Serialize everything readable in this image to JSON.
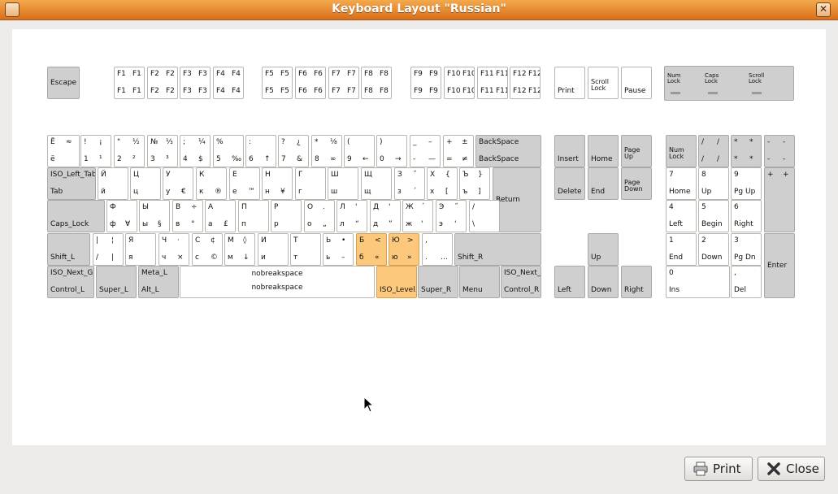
{
  "window": {
    "title": "Keyboard Layout \"Russian\"",
    "close_glyph": "✕"
  },
  "buttons": {
    "print_label": "Print",
    "close_label": "Close"
  },
  "keyboard": {
    "keys": [
      {
        "name": "escape",
        "labels": {
          "ml": "Escape"
        },
        "mod": true
      },
      {
        "name": "f1",
        "labels": {
          "tl": "F1",
          "tr": "F1",
          "bl": "F1",
          "br": "F1"
        }
      },
      {
        "name": "f2",
        "labels": {
          "tl": "F2",
          "tr": "F2",
          "bl": "F2",
          "br": "F2"
        }
      },
      {
        "name": "f3",
        "labels": {
          "tl": "F3",
          "tr": "F3",
          "bl": "F3",
          "br": "F3"
        }
      },
      {
        "name": "f4",
        "labels": {
          "tl": "F4",
          "tr": "F4",
          "bl": "F4",
          "br": "F4"
        }
      },
      {
        "name": "f5",
        "labels": {
          "tl": "F5",
          "tr": "F5",
          "bl": "F5",
          "br": "F5"
        }
      },
      {
        "name": "f6",
        "labels": {
          "tl": "F6",
          "tr": "F6",
          "bl": "F6",
          "br": "F6"
        }
      },
      {
        "name": "f7",
        "labels": {
          "tl": "F7",
          "tr": "F7",
          "bl": "F7",
          "br": "F7"
        }
      },
      {
        "name": "f8",
        "labels": {
          "tl": "F8",
          "tr": "F8",
          "bl": "F8",
          "br": "F8"
        }
      },
      {
        "name": "f9",
        "labels": {
          "tl": "F9",
          "tr": "F9",
          "bl": "F9",
          "br": "F9"
        }
      },
      {
        "name": "f10",
        "labels": {
          "tl": "F10",
          "tr": "F10",
          "bl": "F10",
          "br": "F10"
        }
      },
      {
        "name": "f11",
        "labels": {
          "tl": "F11",
          "tr": "F11",
          "bl": "F11",
          "br": "F11"
        }
      },
      {
        "name": "f12",
        "labels": {
          "tl": "F12",
          "tr": "F12",
          "bl": "F12",
          "br": "F12"
        }
      },
      {
        "name": "print",
        "labels": {
          "bl": "Print"
        }
      },
      {
        "name": "scroll-lock",
        "labels": {
          "ml": "Scroll\nLock"
        }
      },
      {
        "name": "pause",
        "labels": {
          "bl": "Pause"
        }
      },
      {
        "name": "grave",
        "labels": {
          "tl": "Ё",
          "tr": "≈",
          "bl": "ё",
          "br": ""
        }
      },
      {
        "name": "digit-1",
        "labels": {
          "tl": "!",
          "tr": "¡",
          "bl": "1",
          "br": "¹"
        }
      },
      {
        "name": "digit-2",
        "labels": {
          "tl": "\"",
          "tr": "½",
          "bl": "2",
          "br": "²"
        }
      },
      {
        "name": "digit-3",
        "labels": {
          "tl": "№",
          "tr": "⅓",
          "bl": "3",
          "br": "³"
        }
      },
      {
        "name": "digit-4",
        "labels": {
          "tl": ";",
          "tr": "¼",
          "bl": "4",
          "br": "$"
        }
      },
      {
        "name": "digit-5",
        "labels": {
          "tl": "%",
          "tr": "",
          "bl": "5",
          "br": "‰"
        }
      },
      {
        "name": "digit-6",
        "labels": {
          "tl": ":",
          "tr": "",
          "bl": "6",
          "br": "↑"
        }
      },
      {
        "name": "digit-7",
        "labels": {
          "tl": "?",
          "tr": "¿",
          "bl": "7",
          "br": "&"
        }
      },
      {
        "name": "digit-8",
        "labels": {
          "tl": "*",
          "tr": "⅛",
          "bl": "8",
          "br": "∞"
        }
      },
      {
        "name": "digit-9",
        "labels": {
          "tl": "(",
          "tr": "",
          "bl": "9",
          "br": "←"
        }
      },
      {
        "name": "digit-0",
        "labels": {
          "tl": ")",
          "tr": "",
          "bl": "0",
          "br": "→"
        }
      },
      {
        "name": "minus",
        "labels": {
          "tl": "_",
          "tr": "–",
          "bl": "-",
          "br": "—"
        }
      },
      {
        "name": "equal",
        "labels": {
          "tl": "+",
          "tr": "±",
          "bl": "=",
          "br": "≠"
        }
      },
      {
        "name": "backspace",
        "labels": {
          "tl": "BackSpace",
          "bl": "BackSpace"
        },
        "mod": true
      },
      {
        "name": "insert",
        "labels": {
          "bl": "Insert"
        },
        "mod": true
      },
      {
        "name": "home",
        "labels": {
          "bl": "Home"
        },
        "mod": true
      },
      {
        "name": "page-up",
        "labels": {
          "ml": "Page\nUp"
        },
        "mod": true
      },
      {
        "name": "num-lock",
        "labels": {
          "ml": "Num\nLock"
        },
        "mod": true
      },
      {
        "name": "kp-divide",
        "labels": {
          "tl": "/",
          "tr": "/",
          "bl": "/",
          "br": "/"
        },
        "mod": true
      },
      {
        "name": "kp-multiply",
        "labels": {
          "tl": "*",
          "tr": "*",
          "bl": "*",
          "br": "*"
        },
        "mod": true
      },
      {
        "name": "kp-subtract",
        "labels": {
          "tl": "-",
          "tr": "-",
          "bl": "-",
          "br": "-"
        },
        "mod": true
      },
      {
        "name": "tab",
        "labels": {
          "tl": "ISO_Left_Tab",
          "bl": "Tab"
        },
        "mod": true
      },
      {
        "name": "q",
        "labels": {
          "tl": "Й",
          "bl": "й"
        }
      },
      {
        "name": "w",
        "labels": {
          "tl": "Ц",
          "bl": "ц"
        }
      },
      {
        "name": "e",
        "labels": {
          "tl": "У",
          "bl": "у",
          "br": "€"
        }
      },
      {
        "name": "r",
        "labels": {
          "tl": "К",
          "bl": "к",
          "br": "®"
        }
      },
      {
        "name": "t",
        "labels": {
          "tl": "Е",
          "bl": "е",
          "br": "™"
        }
      },
      {
        "name": "y",
        "labels": {
          "tl": "Н",
          "bl": "н",
          "br": "¥"
        }
      },
      {
        "name": "u",
        "labels": {
          "tl": "Г",
          "bl": "г"
        }
      },
      {
        "name": "i",
        "labels": {
          "tl": "Ш",
          "bl": "ш"
        }
      },
      {
        "name": "o",
        "labels": {
          "tl": "Щ",
          "bl": "щ"
        }
      },
      {
        "name": "p",
        "labels": {
          "tl": "З",
          "tr": "˝",
          "bl": "з",
          "br": "´"
        }
      },
      {
        "name": "bracket-left",
        "labels": {
          "tl": "Х",
          "tr": "{",
          "bl": "х",
          "br": "["
        }
      },
      {
        "name": "bracket-right",
        "labels": {
          "tl": "Ъ",
          "tr": "}",
          "bl": "ъ",
          "br": "]"
        }
      },
      {
        "name": "return",
        "labels": {
          "ml": "Return"
        },
        "mod": true
      },
      {
        "name": "delete",
        "labels": {
          "bl": "Delete"
        },
        "mod": true
      },
      {
        "name": "end",
        "labels": {
          "bl": "End"
        },
        "mod": true
      },
      {
        "name": "page-down",
        "labels": {
          "ml": "Page\nDown"
        },
        "mod": true
      },
      {
        "name": "kp-7",
        "labels": {
          "tl": "7",
          "bl": "Home"
        }
      },
      {
        "name": "kp-8",
        "labels": {
          "tl": "8",
          "bl": "Up"
        }
      },
      {
        "name": "kp-9",
        "labels": {
          "tl": "9",
          "bl": "Pg Up"
        }
      },
      {
        "name": "kp-add",
        "labels": {
          "tl": "+",
          "tr": "+"
        },
        "mod": true
      },
      {
        "name": "caps-lock",
        "labels": {
          "bl": "Caps_Lock"
        },
        "mod": true
      },
      {
        "name": "a",
        "labels": {
          "tl": "Ф",
          "bl": "ф",
          "br": "ꓯ"
        }
      },
      {
        "name": "s",
        "labels": {
          "tl": "Ы",
          "bl": "ы",
          "br": "§"
        }
      },
      {
        "name": "d",
        "labels": {
          "tl": "В",
          "tr": "÷",
          "bl": "в",
          "br": "°"
        }
      },
      {
        "name": "f",
        "labels": {
          "tl": "А",
          "bl": "а",
          "br": "£"
        }
      },
      {
        "name": "g",
        "labels": {
          "tl": "П",
          "bl": "п"
        }
      },
      {
        "name": "h",
        "labels": {
          "tl": "Р",
          "bl": "р"
        }
      },
      {
        "name": "j",
        "labels": {
          "tl": "О",
          "tr": ".",
          "bl": "о",
          "br": "„"
        }
      },
      {
        "name": "k",
        "labels": {
          "tl": "Л",
          "tr": "'",
          "bl": "л",
          "br": "“"
        }
      },
      {
        "name": "l",
        "labels": {
          "tl": "Д",
          "tr": "'",
          "bl": "д",
          "br": "”"
        }
      },
      {
        "name": "semicolon",
        "labels": {
          "tl": "Ж",
          "tr": "´",
          "bl": "ж",
          "br": "'"
        }
      },
      {
        "name": "apostrophe",
        "labels": {
          "tl": "Э",
          "tr": "˝",
          "bl": "э",
          "br": "'"
        }
      },
      {
        "name": "backslash",
        "labels": {
          "tl": "/",
          "bl": "\\"
        }
      },
      {
        "name": "kp-4",
        "labels": {
          "tl": "4",
          "bl": "Left"
        }
      },
      {
        "name": "kp-5",
        "labels": {
          "tl": "5",
          "bl": "Begin"
        }
      },
      {
        "name": "kp-6",
        "labels": {
          "tl": "6",
          "bl": "Right"
        }
      },
      {
        "name": "shift-l",
        "labels": {
          "bl": "Shift_L"
        },
        "mod": true
      },
      {
        "name": "less-greater",
        "labels": {
          "tl": "|",
          "tr": "¦",
          "bl": "/",
          "br": "|"
        }
      },
      {
        "name": "z",
        "labels": {
          "tl": "Я",
          "bl": "я"
        }
      },
      {
        "name": "x",
        "labels": {
          "tl": "Ч",
          "tr": "·",
          "bl": "ч",
          "br": "×"
        }
      },
      {
        "name": "c",
        "labels": {
          "tl": "С",
          "tr": "¢",
          "bl": "с",
          "br": "©"
        }
      },
      {
        "name": "v",
        "labels": {
          "tl": "М",
          "tr": "◊",
          "bl": "м",
          "br": "↓"
        }
      },
      {
        "name": "b",
        "labels": {
          "tl": "И",
          "bl": "и"
        }
      },
      {
        "name": "n",
        "labels": {
          "tl": "Т",
          "bl": "т"
        }
      },
      {
        "name": "m",
        "labels": {
          "tl": "Ь",
          "tr": "•",
          "bl": "ь",
          "br": "–"
        }
      },
      {
        "name": "comma",
        "labels": {
          "tl": "Б",
          "tr": "<",
          "bl": "б",
          "br": "«"
        },
        "hl": true
      },
      {
        "name": "period",
        "labels": {
          "tl": "Ю",
          "tr": ">",
          "bl": "ю",
          "br": "»"
        },
        "hl": true
      },
      {
        "name": "slash",
        "labels": {
          "tl": ",",
          "bl": ".",
          "br": "…"
        }
      },
      {
        "name": "shift-r",
        "labels": {
          "bl": "Shift_R"
        },
        "mod": true
      },
      {
        "name": "up",
        "labels": {
          "bl": "Up"
        },
        "mod": true
      },
      {
        "name": "kp-1",
        "labels": {
          "tl": "1",
          "bl": "End"
        }
      },
      {
        "name": "kp-2",
        "labels": {
          "tl": "2",
          "bl": "Down"
        }
      },
      {
        "name": "kp-3",
        "labels": {
          "tl": "3",
          "bl": "Pg Dn"
        }
      },
      {
        "name": "kp-enter",
        "labels": {
          "ml": "Enter"
        },
        "mod": true
      },
      {
        "name": "control-l",
        "labels": {
          "tl": "ISO_Next_Gr...",
          "bl": "Control_L"
        },
        "mod": true
      },
      {
        "name": "super-l",
        "labels": {
          "bl": "Super_L"
        },
        "mod": true
      },
      {
        "name": "alt-l",
        "labels": {
          "tl": "Meta_L",
          "bl": "Alt_L"
        },
        "mod": true
      },
      {
        "name": "space",
        "labels": {
          "c1": "nobreakspace",
          "c2": "nobreakspace"
        }
      },
      {
        "name": "alt-r",
        "labels": {
          "bl": "ISO_Level..."
        },
        "hl": true
      },
      {
        "name": "super-r",
        "labels": {
          "bl": "Super_R"
        },
        "mod": true
      },
      {
        "name": "menu",
        "labels": {
          "bl": "Menu"
        },
        "mod": true
      },
      {
        "name": "control-r",
        "labels": {
          "tl": "ISO_Next_...",
          "bl": "Control_R"
        },
        "mod": true
      },
      {
        "name": "left",
        "labels": {
          "bl": "Left"
        },
        "mod": true
      },
      {
        "name": "down",
        "labels": {
          "bl": "Down"
        },
        "mod": true
      },
      {
        "name": "right",
        "labels": {
          "bl": "Right"
        },
        "mod": true
      },
      {
        "name": "kp-0",
        "labels": {
          "tl": "0",
          "bl": "Ins"
        }
      },
      {
        "name": "kp-decimal",
        "labels": {
          "tl": ",",
          "bl": "Del"
        }
      }
    ],
    "indicators": [
      {
        "name": "num-lock-indicator",
        "label": "Num\nLock"
      },
      {
        "name": "caps-lock-indicator",
        "label": "Caps\nLock"
      },
      {
        "name": "scroll-lock-indicator",
        "label": "Scroll\nLock"
      }
    ]
  }
}
